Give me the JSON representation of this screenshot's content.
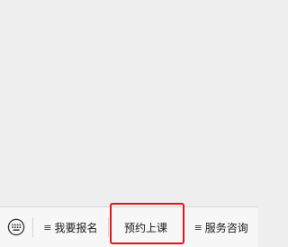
{
  "menu": {
    "keyboard_icon": "keyboard-icon",
    "items": [
      {
        "label": "我要报名",
        "icon": "list-icon",
        "glyph": "≡"
      },
      {
        "label": "预约上课"
      },
      {
        "label": "服务咨询",
        "icon": "list-icon",
        "glyph": "≡"
      }
    ]
  },
  "colors": {
    "chat_background": "#eeeeee",
    "menu_background": "#f7f7f7",
    "highlight": "#e0161d"
  }
}
